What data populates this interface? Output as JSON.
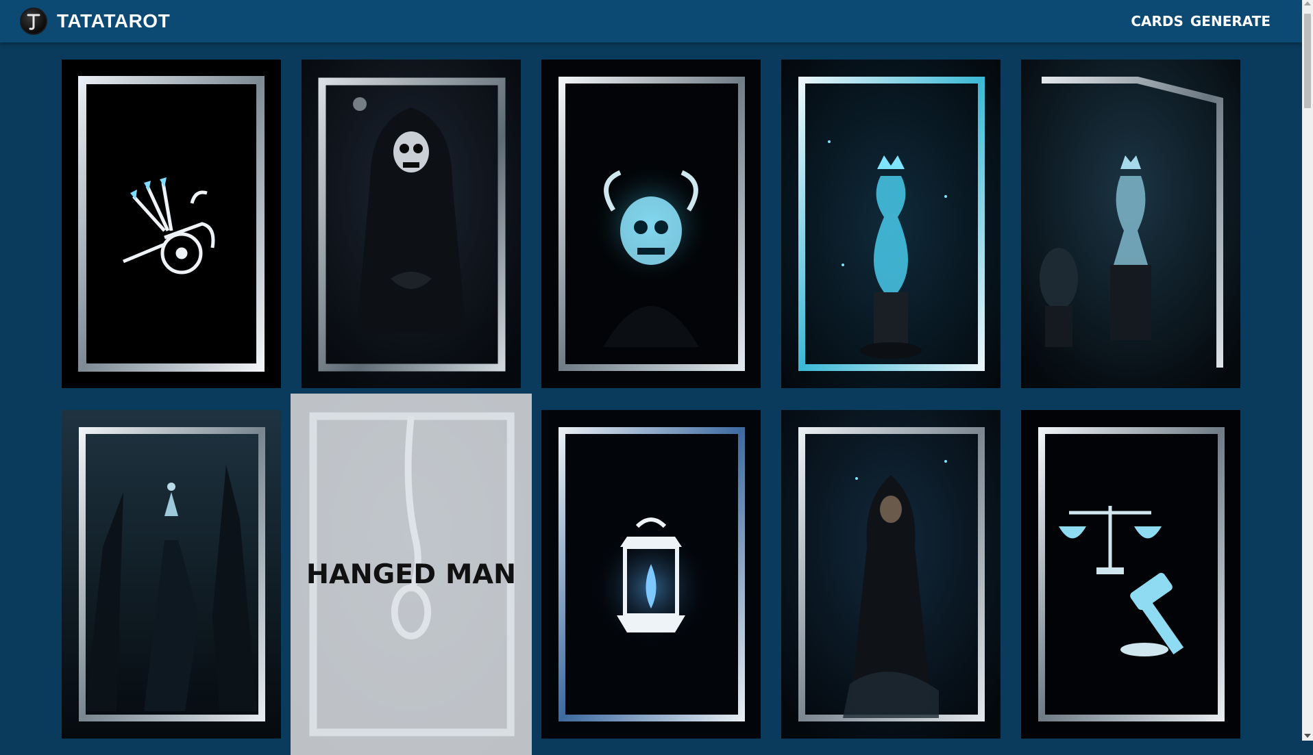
{
  "header": {
    "title": "TATATAROT",
    "nav": [
      {
        "label": "CARDS"
      },
      {
        "label": "GENERATE"
      }
    ]
  },
  "colors": {
    "header_bg": "#0d4a73",
    "page_bg": "#0a3a5c",
    "glow": "#3fd6ff"
  },
  "cards": [
    {
      "icon": "chariot-icon",
      "name": ""
    },
    {
      "icon": "death-skeleton-icon",
      "name": ""
    },
    {
      "icon": "horned-skull-icon",
      "name": ""
    },
    {
      "icon": "queen-chess-icon",
      "name": ""
    },
    {
      "icon": "chess-tower-icon",
      "name": ""
    },
    {
      "icon": "cliff-figure-icon",
      "name": ""
    },
    {
      "icon": "noose-icon",
      "name": "HANGED MAN"
    },
    {
      "icon": "lantern-icon",
      "name": ""
    },
    {
      "icon": "hooded-monk-icon",
      "name": ""
    },
    {
      "icon": "scales-gavel-icon",
      "name": ""
    }
  ]
}
